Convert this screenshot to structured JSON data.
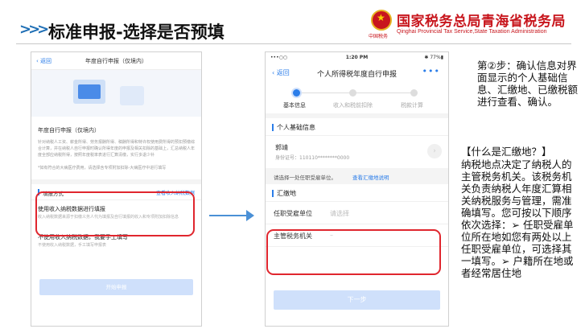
{
  "slide": {
    "chevrons": ">>>",
    "title": "标准申报-选择是否预填",
    "org_cn": "国家税务总局青海省税务局",
    "org_en": "Qinghai Provincial Tax Service,State Taxation Administration",
    "emblem_text": "中国税务"
  },
  "phone1": {
    "back": "返回",
    "nav_title": "年度自行申报（仅境内）",
    "heading": "年度自行申报（仅境内）",
    "body": "针对纳税人工资、薪金所得、劳务报酬所得、稿酬所得和特许权使用费所得的预扣预缴综合计算，并在纳税人自行申报时确认所得年度的申报及相关扣除的基础上，汇总纳税人年度全部应纳税所得，按照年度税率表进行汇算清缴，实行多退少补",
    "note": "*如有符合的大病医疗费用，请选择含专项附加扣除-大病医疗中进行填写",
    "section_label": "填报方式",
    "section_link": "查看收入纳税数据",
    "opt1_title": "使用收入纳税数据进行填报",
    "opt1_desc": "收入纳税数据来源于扣缴义务人代为填报及自行填报的收入和专项附加扣除信息",
    "opt2_title": "不使用收入纳税数据，我要手工填写",
    "opt2_desc": "不使用收入纳税数据，手工填写申报表",
    "start_button": "开始申报"
  },
  "phone2": {
    "signal": "•••○○ ",
    "time": "1:20 PM",
    "battery": "✱ 77%▮",
    "back": "返回",
    "nav_title": "个人所得税年度自行申报",
    "more": "•••",
    "steps": [
      "基本信息",
      "收入和税前扣除",
      "税款计算"
    ],
    "section1": "个人基础信息",
    "name": "郭靖",
    "id_label": "身份证号：110110********0000",
    "hint_text": "请选择一处任职受雇单位。",
    "hint_link": "查看汇缴地说明",
    "section2": "汇缴地",
    "row1_label": "任职受雇单位",
    "row1_value": "请选择",
    "row2_label": "主管税务机关",
    "row2_value": "–",
    "next_button": "下一步"
  },
  "right": {
    "step2": "第②步：确认信息对界面显示的个人基础信息、汇缴地、已缴税额进行查看、确认。",
    "whatis_title": "【什么是汇缴地？】",
    "whatis_body": "纳税地点决定了纳税人的主管税务机关。该税务机关负责纳税人年度汇算相关纳税服务与管理，需准确填写。您可按以下顺序依次选择：➢ 任职受雇单位所在地如您有两处以上任职受雇单位，可选择其一填写。➢ 户籍所在地或者经常居住地"
  },
  "colors": {
    "accent": "#2b7de9",
    "highlight": "#e0262e",
    "brand": "#c8161d",
    "arrow": "#4a90d6"
  }
}
